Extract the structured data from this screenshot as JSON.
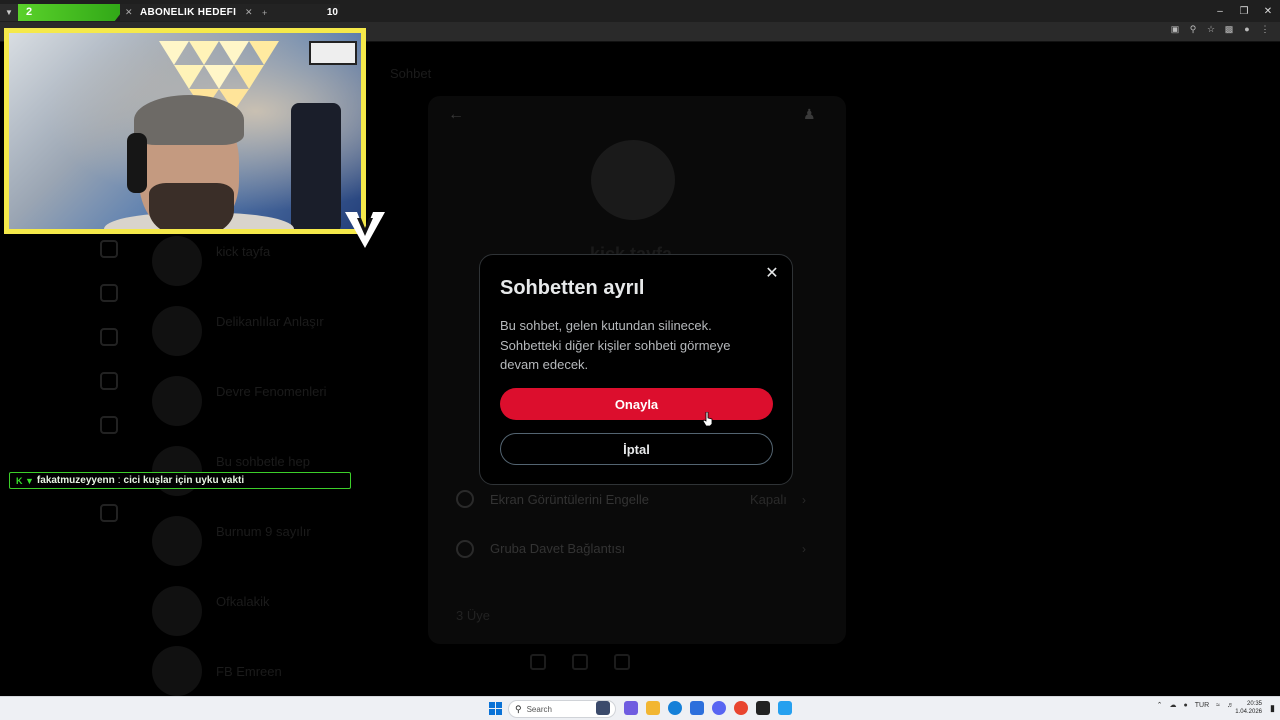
{
  "stream_overlay": {
    "goal": {
      "current": "2",
      "title": "ABONELIK HEDEFI",
      "target": "10"
    },
    "chat": {
      "user": "fakatmuzeyyenn",
      "separator": ":",
      "message": "cici kuşlar için uyku vakti"
    }
  },
  "modal": {
    "title": "Sohbetten ayrıl",
    "body": "Bu sohbet, gelen kutundan silinecek. Sohbetteki diğer kişiler sohbeti görmeye devam edecek.",
    "confirm_label": "Onayla",
    "cancel_label": "İptal",
    "confirm_color": "#dc0e2d"
  },
  "background": {
    "panel_name": "kick tayfa",
    "rows": [
      {
        "label": "Ekran Görüntülerini Engelle",
        "value": "Kapalı"
      },
      {
        "label": "Gruba Davet Bağlantısı",
        "value": ""
      }
    ],
    "footer": "3 Üye",
    "conversations": [
      {
        "name": "kick tayfa"
      },
      {
        "name": "Delikanlılar Anlaşır"
      },
      {
        "name": "Devre Fenomenleri"
      },
      {
        "name": "Bu sohbetle hep"
      },
      {
        "name": "Burnum 9 sayılır"
      },
      {
        "name": "Ofkalakik"
      },
      {
        "name": "FB Emreen"
      }
    ],
    "header_tab": "Sohbet"
  },
  "taskbar": {
    "search_placeholder": "Search",
    "tray_lang": "TUR",
    "time": "20:35",
    "date": "1.04.2026"
  },
  "colors": {
    "accent_red": "#dc0e2d",
    "goal_green": "#3cbf1f",
    "webcam_border": "#f5e94a",
    "chat_border": "#3ccf2a"
  }
}
